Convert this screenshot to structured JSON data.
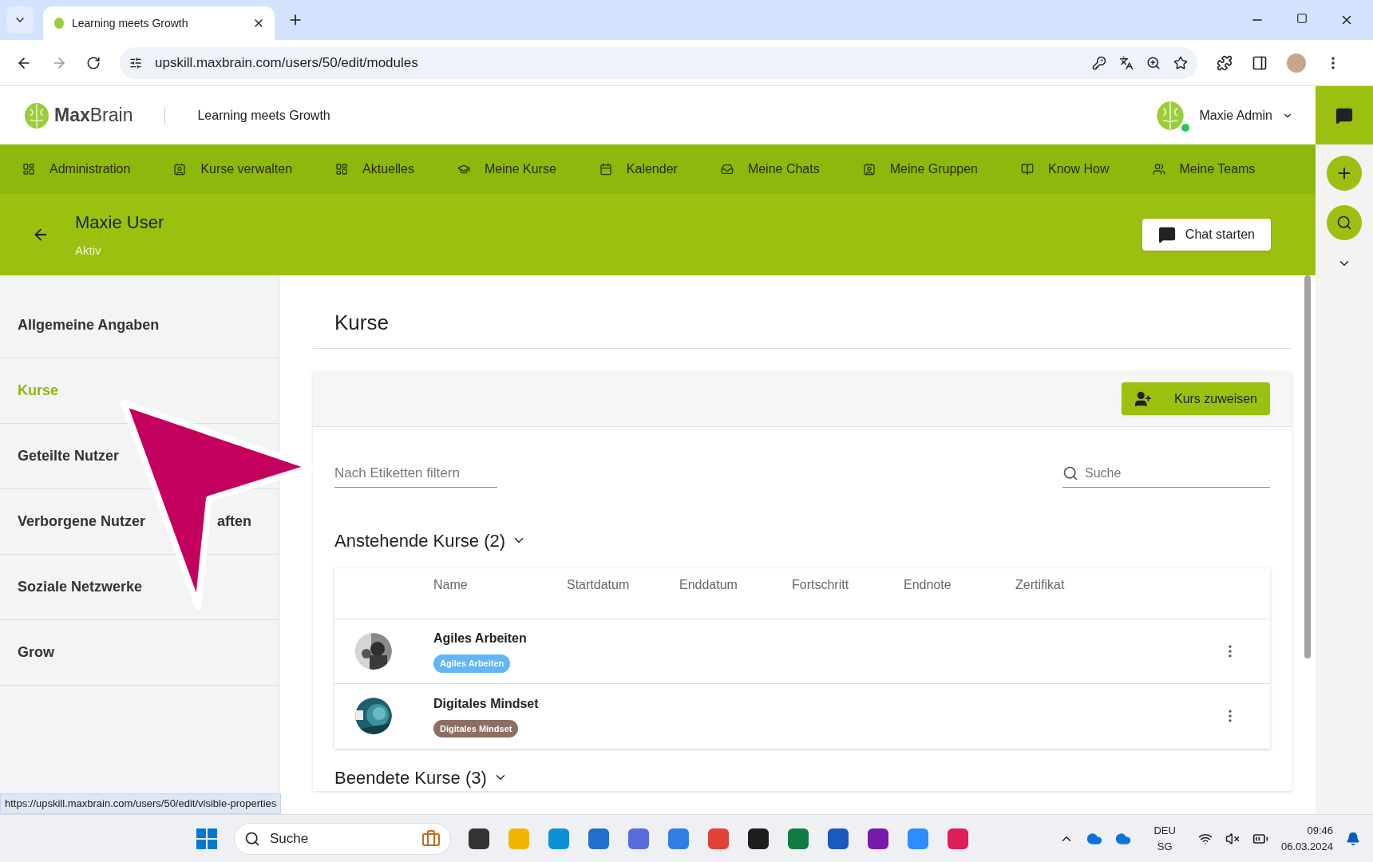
{
  "browser": {
    "tab_title": "Learning meets Growth",
    "url": "upskill.maxbrain.com/users/50/edit/modules",
    "status_url": "https://upskill.maxbrain.com/users/50/edit/visible-properties"
  },
  "header": {
    "logo_bold": "Max",
    "logo_light": "Brain",
    "tagline": "Learning meets Growth",
    "user_name": "Maxie Admin",
    "online": true
  },
  "nav": [
    "Administration",
    "Kurse verwalten",
    "Aktuelles",
    "Meine Kurse",
    "Kalender",
    "Meine Chats",
    "Meine Gruppen",
    "Know How",
    "Meine Teams"
  ],
  "user": {
    "name": "Maxie User",
    "status": "Aktiv",
    "chat_button": "Chat starten"
  },
  "sidebar": [
    {
      "label": "Allgemeine Angaben",
      "selected": false
    },
    {
      "label": "Kurse",
      "selected": true
    },
    {
      "label": "Geteilte Nutzer",
      "selected": false
    },
    {
      "label": "Verborgene Nutzer",
      "tail": "aften",
      "selected": false
    },
    {
      "label": "Soziale Netzwerke",
      "selected": false
    },
    {
      "label": "Grow",
      "selected": false
    }
  ],
  "main": {
    "title": "Kurse",
    "assign_button": "Kurs zuweisen",
    "filter_placeholder": "Nach Etiketten filtern",
    "search_placeholder": "Suche",
    "upcoming": {
      "title": "Anstehende Kurse (2)",
      "columns": [
        "Name",
        "Startdatum",
        "Enddatum",
        "Fortschritt",
        "Endnote",
        "Zertifikat"
      ],
      "rows": [
        {
          "name": "Agiles Arbeiten",
          "tag": "Agiles Arbeiten",
          "color": "#64b5f6"
        },
        {
          "name": "Digitales Mindset",
          "tag": "Digitales Mindset",
          "color": "#8d6e63"
        }
      ]
    },
    "finished": {
      "title": "Beendete Kurse (3)"
    }
  },
  "taskbar": {
    "search": "Suche",
    "language": "DEU",
    "region": "SG",
    "time": "09:46",
    "date": "06.03.2024"
  }
}
